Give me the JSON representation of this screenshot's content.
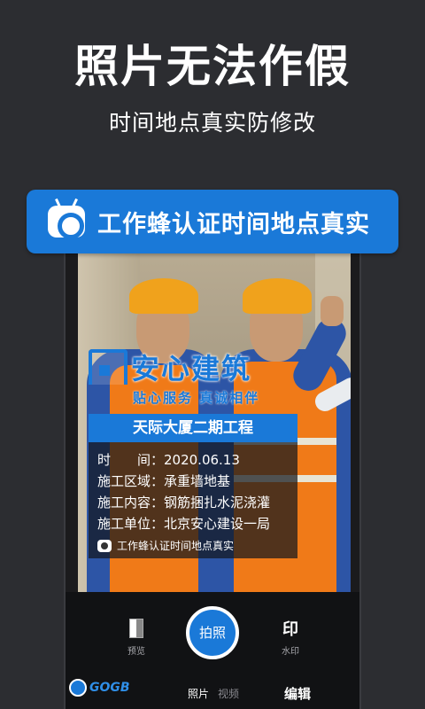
{
  "headline": "照片无法作假",
  "subline": "时间地点真实防修改",
  "banner": {
    "text": "工作蜂认证时间地点真实",
    "icon": "camera-icon"
  },
  "watermark": {
    "brand": "安心建筑",
    "slogan": "贴心服务 真诚相伴",
    "project": "天际大厦二期工程",
    "lines": [
      "时　　间：2020.06.13",
      "施工区域：承重墙地基",
      "施工内容：钢筋捆扎水泥浇灌",
      "施工单位：北京安心建设一局"
    ],
    "footer": "工作蜂认证时间地点真实"
  },
  "camera": {
    "preview_label": "预览",
    "shutter_label": "拍照",
    "watermark_glyph": "印",
    "watermark_label": "水印",
    "modes": [
      "照片",
      "视频"
    ],
    "edit_label": "编辑"
  },
  "colors": {
    "background": "#2c2d31",
    "accent": "#1a79d8",
    "vest": "#f07a18",
    "helmet": "#f0a21c"
  }
}
